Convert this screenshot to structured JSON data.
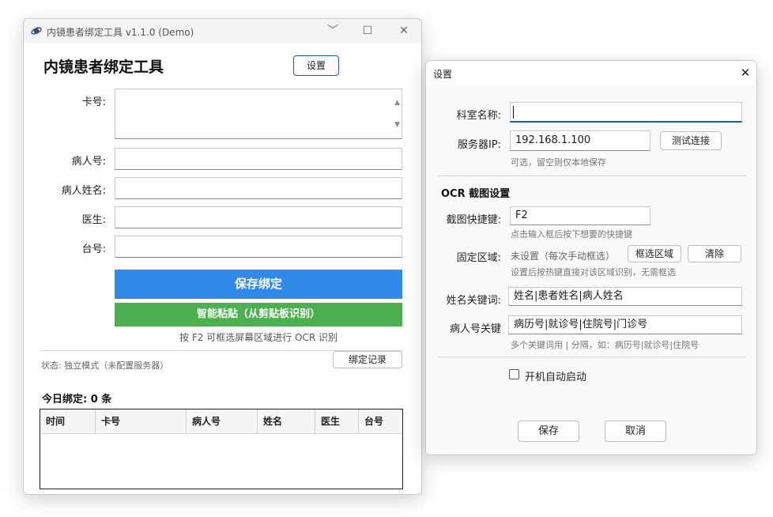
{
  "main_window": {
    "title": "内镜患者绑定工具 v1.1.0 (Demo)",
    "controls": {
      "minimize": "﹀",
      "maximize": "☐",
      "close": "✕"
    },
    "heading": "内镜患者绑定工具",
    "settings_button": "设置",
    "fields": {
      "card_label": "卡号:",
      "patient_id_label": "病人号:",
      "patient_name_label": "病人姓名:",
      "doctor_label": "医生:",
      "station_label": "台号:"
    },
    "save_button": "保存绑定",
    "paste_button": "智能粘贴（从剪贴板识别）",
    "ocr_hint": "按 F2 可框选屏幕区域进行 OCR 识别",
    "status": "状态: 独立模式（未配置服务器）",
    "records_button": "绑定记录",
    "today_prefix": "今日绑定: ",
    "today_count": "0",
    "today_suffix": " 条",
    "table_columns": [
      "时间",
      "卡号",
      "病人号",
      "姓名",
      "医生",
      "台号"
    ]
  },
  "settings_window": {
    "title": "设置",
    "close": "✕",
    "dept_label": "科室名称:",
    "dept_value": "",
    "server_label": "服务器IP:",
    "server_value": "192.168.1.100",
    "test_button": "测试连接",
    "server_hint": "可选，留空则仅本地保存",
    "ocr_section": "OCR 截图设置",
    "hotkey_label": "截图快捷键:",
    "hotkey_value": "F2",
    "hotkey_hint": "点击输入框后按下想要的快捷键",
    "region_label": "固定区域:",
    "region_value": "未设置（每次手动框选）",
    "select_region_button": "框选区域",
    "clear_button": "清除",
    "region_hint": "设置后按热键直接对该区域识别，无需框选",
    "name_kw_label": "姓名关键词:",
    "name_kw_value": "姓名|患者姓名|病人姓名",
    "pid_kw_label": "病人号关键",
    "pid_kw_value": "病历号|就诊号|住院号|门诊号",
    "pid_kw_hint": "多个关键词用 | 分隔，如：病历号|就诊号|住院号",
    "autostart_label": "开机自动启动",
    "autostart_checked": false,
    "save_button": "保存",
    "cancel_button": "取消"
  },
  "colors": {
    "save_blue": "#2f8ae8",
    "paste_green": "#4caf50",
    "accent_border": "#1a5fa8"
  }
}
